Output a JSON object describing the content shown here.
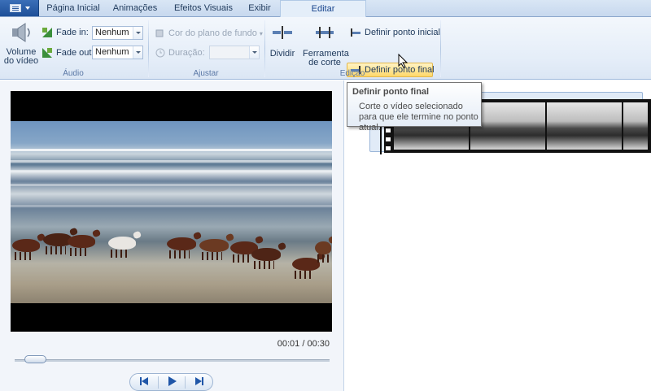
{
  "tabs": {
    "file_menu": "file-menu",
    "items": [
      "Página Inicial",
      "Animações",
      "Efeitos Visuais",
      "Exibir",
      "Editar"
    ],
    "active": "Editar"
  },
  "audio_group": {
    "label": "Áudio",
    "volume_line1": "Volume",
    "volume_line2": "do vídeo",
    "fade_in_label": "Fade in:",
    "fade_in_value": "Nenhum",
    "fade_out_label": "Fade out:",
    "fade_out_value": "Nenhum"
  },
  "adjust_group": {
    "label": "Ajustar",
    "bg_color_label": "Cor do plano de fundo",
    "duration_label": "Duração:",
    "duration_value": ""
  },
  "edit_group": {
    "label": "Edição",
    "split_label": "Dividir",
    "trim_line1": "Ferramenta",
    "trim_line2": "de corte",
    "set_start_label": "Definir ponto inicial",
    "set_end_label": "Definir ponto final"
  },
  "tooltip": {
    "title": "Definir ponto final",
    "body": "Corte o vídeo selecionado para que ele termine no ponto atual."
  },
  "player": {
    "time": "00:01 / 00:30",
    "progress": 0.033
  },
  "colors": {
    "accent": "#15428b",
    "highlight": "#ffd86a",
    "context_tab": "#8fd34a"
  }
}
